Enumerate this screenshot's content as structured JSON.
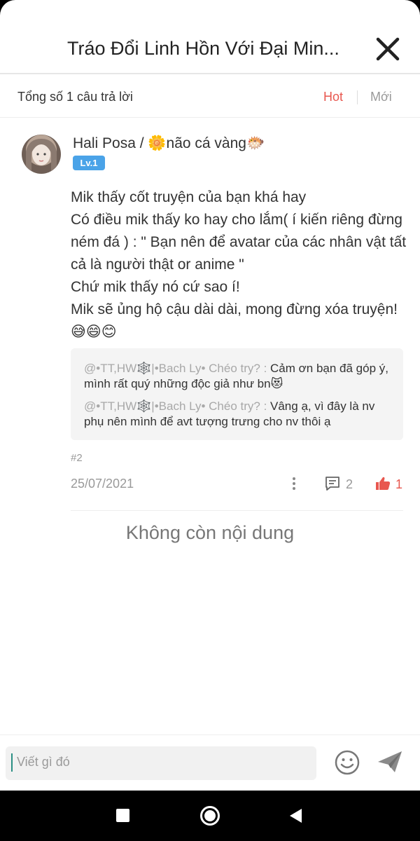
{
  "header": {
    "title": "Tráo Đổi Linh Hồn Với Đại Min...",
    "close_icon": "close-icon"
  },
  "summary_bar": {
    "summary": "Tổng số 1 câu trả lời",
    "tabs": [
      {
        "label": "Hot",
        "active": true
      },
      {
        "label": "Mới",
        "active": false
      }
    ]
  },
  "comment": {
    "author": "Hali Posa / 🌼não cá vàng🐡",
    "level": "Lv.1",
    "body": "Mik thấy cốt truyện của bạn khá hay\nCó điều mik thấy ko hay cho lắm( í kiến riêng đừng ném đá ) : \" Bạn nên để avatar của các nhân vật tất cả là người thật or anime \"\nChứ mik thấy nó cứ sao í!\nMik sẽ ủng hộ cậu dài dài, mong đừng xóa truyện! 😅😄😊",
    "replies": [
      {
        "mention": "@•TT,HW🕸️|•Bach Ly• Chéo try? : ",
        "text": "Cảm ơn bạn đã góp ý, mình rất quý những độc giả như bn😻"
      },
      {
        "mention": "@•TT,HW🕸️|•Bach Ly• Chéo try? : ",
        "text": "Vâng ạ, vì đây là nv phụ nên mình để avt tượng trưng cho nv thôi ạ"
      }
    ],
    "post_number": "#2",
    "date": "25/07/2021",
    "reply_count": "2",
    "like_count": "1"
  },
  "end_text": "Không còn nội dung",
  "input": {
    "placeholder": "Viết gì đó"
  },
  "colors": {
    "accent": "#e8574f",
    "badge": "#4aa3e8",
    "muted": "#999999"
  }
}
